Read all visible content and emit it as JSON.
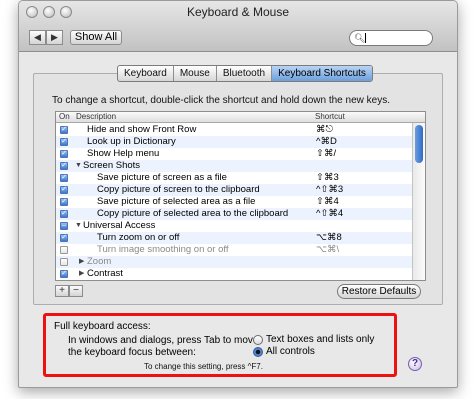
{
  "window": {
    "title": "Keyboard & Mouse"
  },
  "toolbar": {
    "back_icon": "◀",
    "forward_icon": "▶",
    "show_all_label": "Show All",
    "search_value": ""
  },
  "tabs": [
    {
      "label": "Keyboard",
      "active": false
    },
    {
      "label": "Mouse",
      "active": false
    },
    {
      "label": "Bluetooth",
      "active": false
    },
    {
      "label": "Keyboard Shortcuts",
      "active": true
    }
  ],
  "instruction": "To change a shortcut, double-click the shortcut and hold down the new keys.",
  "table": {
    "headers": {
      "on": "On",
      "description": "Description",
      "shortcut": "Shortcut"
    },
    "rows": [
      {
        "checked": "on",
        "indent": 1,
        "desc": "Hide and show Front Row",
        "shortcut": "⌘⎋",
        "gray": false
      },
      {
        "checked": "on",
        "indent": 1,
        "desc": "Look up in Dictionary",
        "shortcut": "^⌘D",
        "gray": false
      },
      {
        "checked": "on",
        "indent": 1,
        "desc": "Show Help menu",
        "shortcut": "⇧⌘/",
        "gray": false
      },
      {
        "checked": "on",
        "indent": 0,
        "desc": "Screen Shots",
        "shortcut": "",
        "gray": false,
        "group": "open"
      },
      {
        "checked": "on",
        "indent": 2,
        "desc": "Save picture of screen as a file",
        "shortcut": "⇧⌘3",
        "gray": false
      },
      {
        "checked": "on",
        "indent": 2,
        "desc": "Copy picture of screen to the clipboard",
        "shortcut": "^⇧⌘3",
        "gray": false
      },
      {
        "checked": "on",
        "indent": 2,
        "desc": "Save picture of selected area as a file",
        "shortcut": "⇧⌘4",
        "gray": false
      },
      {
        "checked": "on",
        "indent": 2,
        "desc": "Copy picture of selected area to the clipboard",
        "shortcut": "^⇧⌘4",
        "gray": false
      },
      {
        "checked": "mixed",
        "indent": 0,
        "desc": "Universal Access",
        "shortcut": "",
        "gray": false,
        "group": "open"
      },
      {
        "checked": "on",
        "indent": 2,
        "desc": "Turn zoom on or off",
        "shortcut": "⌥⌘8",
        "gray": false
      },
      {
        "checked": "off",
        "indent": 2,
        "desc": "Turn image smoothing on or off",
        "shortcut": "⌥⌘\\",
        "gray": true
      },
      {
        "checked": "off",
        "indent": 1,
        "desc": "Zoom",
        "shortcut": "",
        "gray": true,
        "group": "closed"
      },
      {
        "checked": "on",
        "indent": 1,
        "desc": "Contrast",
        "shortcut": "",
        "gray": false,
        "group": "closed"
      }
    ]
  },
  "list_controls": {
    "add_label": "+",
    "remove_label": "−"
  },
  "restore_label": "Restore Defaults",
  "full_keyboard_access": {
    "heading": "Full keyboard access:",
    "line1": "In windows and dialogs, press Tab to move",
    "line2": "the keyboard focus between:",
    "options": [
      {
        "label": "Text boxes and lists only",
        "selected": false
      },
      {
        "label": "All controls",
        "selected": true
      }
    ],
    "note": "To change this setting, press ^F7."
  },
  "help_label": "?",
  "colors": {
    "highlight_border": "#ee1111",
    "accent": "#3d77d1"
  }
}
